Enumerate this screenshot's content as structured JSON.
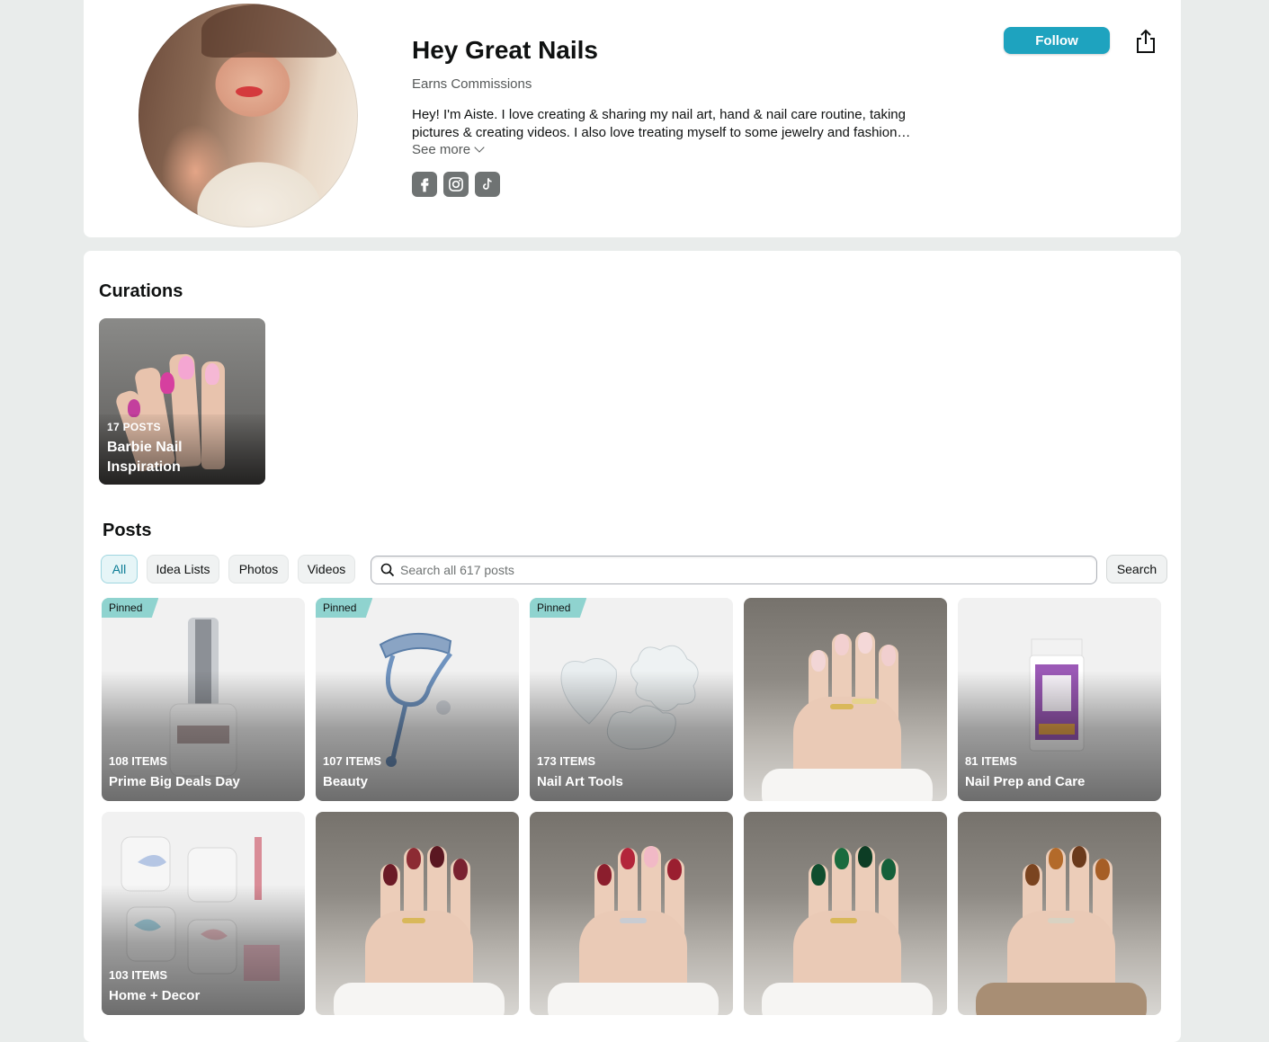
{
  "profile": {
    "name": "Hey Great Nails",
    "earns": "Earns Commissions",
    "bio": "Hey! I'm Aiste. I love creating & sharing my nail art, hand & nail care routine, taking pictures & creating videos. I also love treating myself to some jewelry and fashion…",
    "see_more": "See more",
    "follow_label": "Follow",
    "social": [
      "facebook-icon",
      "instagram-icon",
      "tiktok-icon"
    ],
    "accent_color": "#1ea3bf"
  },
  "curations": {
    "title": "Curations",
    "items": [
      {
        "count": "17 POSTS",
        "title": "Barbie Nail Inspiration"
      }
    ]
  },
  "posts": {
    "title": "Posts",
    "filters": [
      "All",
      "Idea Lists",
      "Photos",
      "Videos"
    ],
    "active_filter": "All",
    "search_placeholder": "Search all 617 posts",
    "search_button": "Search",
    "pinned_label": "Pinned",
    "row1": [
      {
        "pinned": true,
        "count": "108 ITEMS",
        "title": "Prime Big Deals Day"
      },
      {
        "pinned": true,
        "count": "107 ITEMS",
        "title": "Beauty"
      },
      {
        "pinned": true,
        "count": "173 ITEMS",
        "title": "Nail Art Tools"
      },
      {
        "pinned": false,
        "count": "",
        "title": ""
      },
      {
        "pinned": false,
        "count": "81 ITEMS",
        "title": "Nail Prep and Care"
      }
    ],
    "row2": [
      {
        "pinned": false,
        "count": "103 ITEMS",
        "title": "Home + Decor"
      },
      {
        "pinned": false,
        "count": "",
        "title": ""
      },
      {
        "pinned": false,
        "count": "",
        "title": ""
      },
      {
        "pinned": false,
        "count": "",
        "title": ""
      },
      {
        "pinned": false,
        "count": "",
        "title": ""
      }
    ]
  }
}
